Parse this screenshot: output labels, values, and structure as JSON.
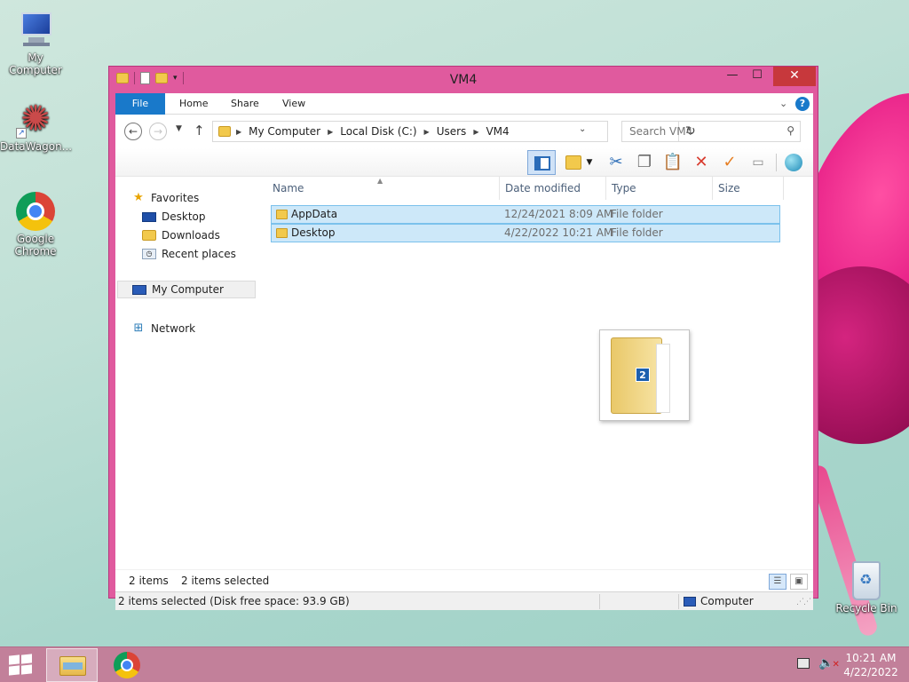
{
  "desktop": {
    "icons": [
      {
        "label": "My Computer"
      },
      {
        "label": "DataWagon..."
      },
      {
        "label": "Google Chrome"
      },
      {
        "label": "Recycle Bin"
      }
    ]
  },
  "window": {
    "title": "VM4",
    "controls": {
      "minimize": "—",
      "maximize": "☐",
      "close": "✕"
    },
    "ribbon_tabs": [
      {
        "label": "File",
        "active": true
      },
      {
        "label": "Home"
      },
      {
        "label": "Share"
      },
      {
        "label": "View"
      }
    ],
    "help": "?"
  },
  "address": {
    "crumbs": [
      "My Computer",
      "Local Disk (C:)",
      "Users",
      "VM4"
    ]
  },
  "search": {
    "placeholder": "Search VM4"
  },
  "nav_pane": {
    "favorites": {
      "label": "Favorites",
      "items": [
        {
          "label": "Desktop"
        },
        {
          "label": "Downloads"
        },
        {
          "label": "Recent places"
        }
      ]
    },
    "computer": {
      "label": "My Computer",
      "selected": true
    },
    "network": {
      "label": "Network"
    }
  },
  "file_list": {
    "columns": [
      "Name",
      "Date modified",
      "Type",
      "Size"
    ],
    "rows": [
      {
        "name": "AppData",
        "date": "12/24/2021 8:09 AM",
        "type": "File folder",
        "size": "",
        "selected": true
      },
      {
        "name": "Desktop",
        "date": "4/22/2022 10:21 AM",
        "type": "File folder",
        "size": "",
        "selected": true
      }
    ]
  },
  "drag_preview": {
    "count": "2"
  },
  "status": {
    "item_count": "2 items",
    "selected": "2 items selected",
    "bar_text": "2 items selected (Disk free space: 93.9 GB)",
    "location": "Computer"
  },
  "taskbar": {
    "time": "10:21 AM",
    "date": "4/22/2022"
  },
  "colors": {
    "window_frame": "#e05a9e",
    "ribbon_file_tab": "#1979ca",
    "selection_fill": "#cde8f9",
    "selection_border": "#7bc1ec",
    "close_button": "#c7383c"
  }
}
